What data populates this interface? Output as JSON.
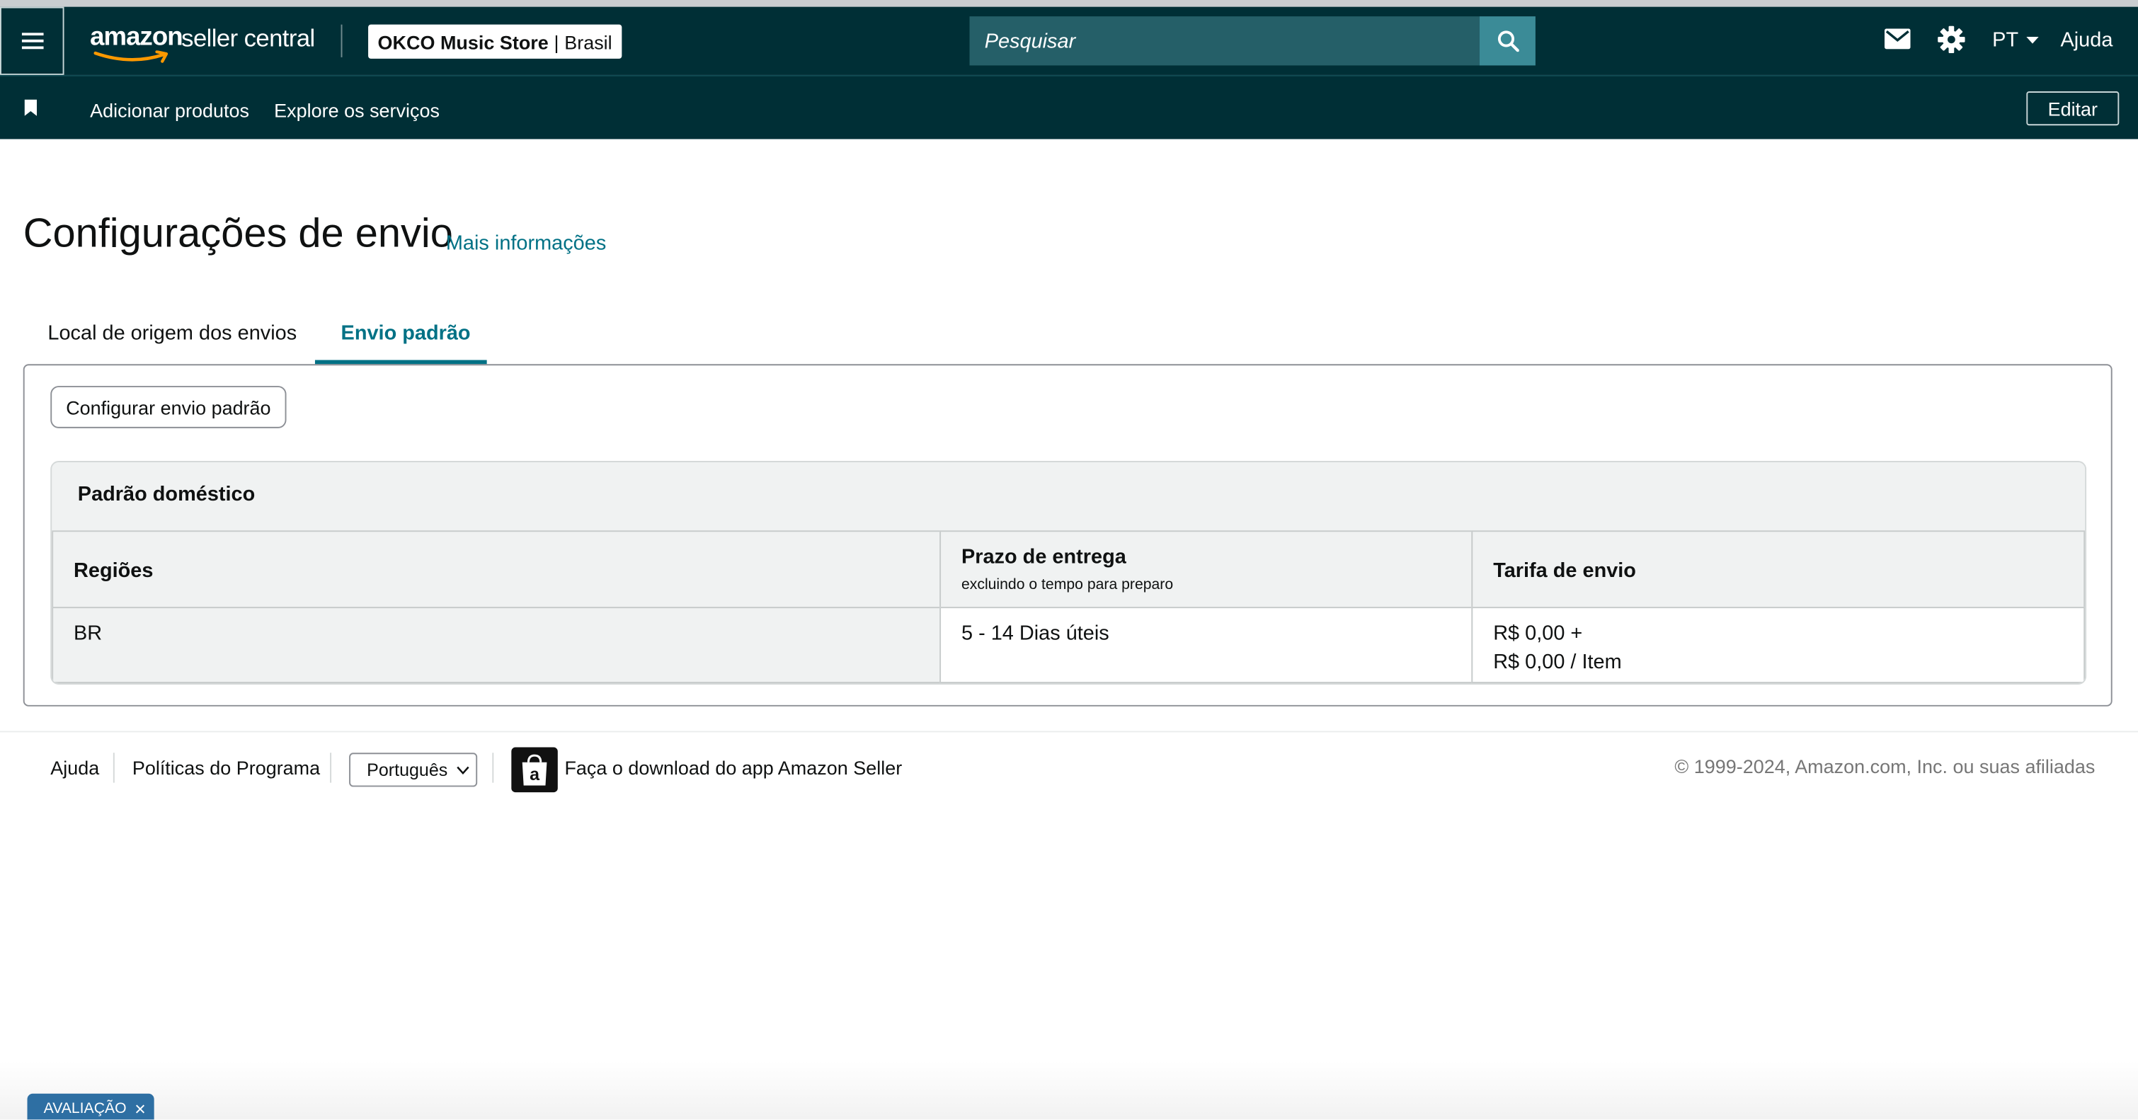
{
  "header": {
    "logo_primary": "amazon",
    "logo_secondary": "seller central",
    "store_name": "OKCO Music Store",
    "store_separator": "|",
    "store_country": "Brasil",
    "search_placeholder": "Pesquisar",
    "language": "PT",
    "help_label": "Ajuda",
    "icons": [
      "menu-icon",
      "search-icon",
      "mail-icon",
      "gear-icon",
      "caret-down-icon"
    ]
  },
  "subnav": {
    "bookmark_icon": "bookmark-icon",
    "links": [
      "Adicionar produtos",
      "Explore os serviços"
    ],
    "edit_label": "Editar"
  },
  "page": {
    "title": "Configurações de envio",
    "more_info": "Mais informações",
    "tabs": [
      {
        "label": "Local de origem dos envios",
        "active": false
      },
      {
        "label": "Envio padrão",
        "active": true
      }
    ],
    "configure_button": "Configurar envio padrão"
  },
  "card": {
    "title": "Padrão doméstico",
    "columns": [
      {
        "label": "Regiões",
        "sub": ""
      },
      {
        "label": "Prazo de entrega",
        "sub": "excluindo o tempo para preparo"
      },
      {
        "label": "Tarifa de envio",
        "sub": ""
      }
    ],
    "rows": [
      {
        "region": "BR",
        "delivery": "5 - 14 Dias úteis",
        "fee_line1": "R$ 0,00 +",
        "fee_line2": "R$ 0,00 / Item"
      }
    ]
  },
  "footer": {
    "help": "Ajuda",
    "policies": "Políticas do Programa",
    "language_select": "Português",
    "app_download": "Faça o download do app Amazon Seller",
    "copyright": "© 1999-2024, Amazon.com, Inc. ou suas afiliadas"
  },
  "eval_tab": {
    "label": "AVALIAÇÃO",
    "close": "×"
  },
  "colors": {
    "nav_bg": "#002f36",
    "search_bg": "#255f68",
    "search_button": "#3b8b97",
    "link": "#007185",
    "eval_tab": "#2e6fa3"
  }
}
